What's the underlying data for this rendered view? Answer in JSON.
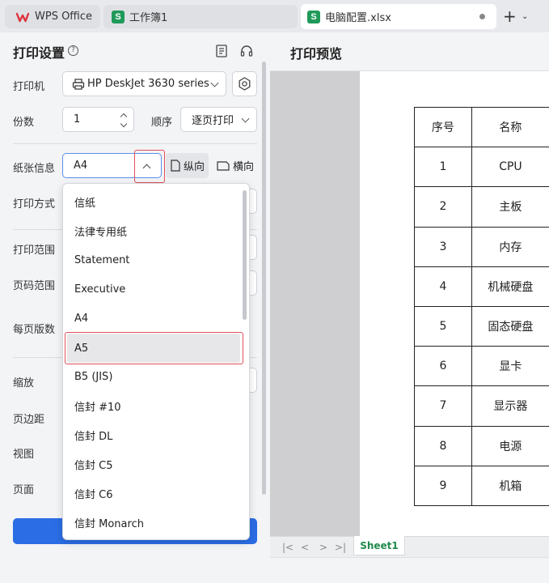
{
  "tabs": {
    "wps_label": "WPS Office",
    "book_label": "工作簿1",
    "active_label": "电脑配置.xlsx",
    "sheet_icon_letter": "S"
  },
  "colors": {
    "brand_red": "#e0323c",
    "primary_blue": "#2b6de5",
    "sheet_green": "#1f9a5a",
    "highlight": "#e0505a"
  },
  "print_settings": {
    "title": "打印设置",
    "printer_label": "打印机",
    "printer_value": "HP DeskJet 3630 series",
    "copies_label": "份数",
    "copies_value": "1",
    "order_label": "顺序",
    "order_value": "逐页打印",
    "paper_label": "纸张信息",
    "paper_value": "A4",
    "portrait_label": "纵向",
    "landscape_label": "横向",
    "print_mode_label": "打印方式",
    "print_range_label": "打印范围",
    "page_range_label": "页码范围",
    "per_page_label": "每页版数",
    "scale_label": "缩放",
    "margin_label": "页边距",
    "view_label": "视图",
    "page_label": "页面"
  },
  "paper_dropdown": {
    "items": [
      "信纸",
      "法律专用纸",
      "Statement",
      "Executive",
      "A4",
      "A5",
      "B5 (JIS)",
      "信封 #10",
      "信封 DL",
      "信封 C5",
      "信封 C6",
      "信封 Monarch"
    ],
    "selected": "A5"
  },
  "preview": {
    "title": "打印预览",
    "headers": [
      "序号",
      "名称"
    ],
    "rows": [
      [
        "1",
        "CPU"
      ],
      [
        "2",
        "主板"
      ],
      [
        "3",
        "内存"
      ],
      [
        "4",
        "机械硬盘"
      ],
      [
        "5",
        "固态硬盘"
      ],
      [
        "6",
        "显卡"
      ],
      [
        "7",
        "显示器"
      ],
      [
        "8",
        "电源"
      ],
      [
        "9",
        "机箱"
      ]
    ],
    "sheet_tab": "Sheet1"
  }
}
